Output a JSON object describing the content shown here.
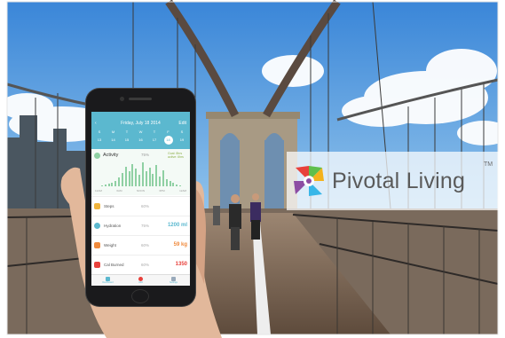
{
  "brand": {
    "name": "Pivotal Living",
    "trademark": "TM",
    "logo_colors": [
      "#e8413c",
      "#f4b21c",
      "#38b6e8",
      "#8c4ca3",
      "#5fbf4c"
    ]
  },
  "app": {
    "accent": "#5bb8cf",
    "header": {
      "back_label": "‹",
      "date": "Friday, July 18 2014",
      "edit_label": "Edit"
    },
    "week_days": [
      "S",
      "M",
      "T",
      "W",
      "T",
      "F",
      "S"
    ],
    "week_dates": [
      "13",
      "14",
      "15",
      "16",
      "17",
      "18",
      "19"
    ],
    "selected_day_index": 5,
    "activity": {
      "label": "Activity",
      "percent": "75%",
      "goal_text": "Goal: 8hrs active: 6hrs",
      "axis_labels": [
        "12AM",
        "6AM",
        "NOON",
        "6PM",
        "12AM"
      ],
      "hourly_levels": [
        0.05,
        0.08,
        0.1,
        0.15,
        0.2,
        0.35,
        0.55,
        0.8,
        0.6,
        0.9,
        0.7,
        0.45,
        0.95,
        0.6,
        0.75,
        0.5,
        0.85,
        0.4,
        0.65,
        0.3,
        0.2,
        0.15,
        0.08,
        0.05
      ]
    },
    "metrics": [
      {
        "label": "Steps",
        "percent": "60%",
        "value": "",
        "icon": "steps-icon",
        "color": "#f0b43c"
      },
      {
        "label": "Hydration",
        "percent": "75%",
        "value": "1200 ml",
        "icon": "droplet-icon",
        "color": "#5bb8cf"
      },
      {
        "label": "Weight",
        "percent": "60%",
        "value": "59 kg",
        "icon": "scale-icon",
        "color": "#f08a3c"
      },
      {
        "label": "Cal Burned",
        "percent": "60%",
        "value": "1350",
        "icon": "flame-icon",
        "color": "#e8413c"
      }
    ],
    "tabs": [
      {
        "label": "Dashboard",
        "icon": "dashboard-icon"
      },
      {
        "label": "Add",
        "icon": "add-icon"
      },
      {
        "label": "Settings",
        "icon": "settings-icon"
      }
    ]
  }
}
